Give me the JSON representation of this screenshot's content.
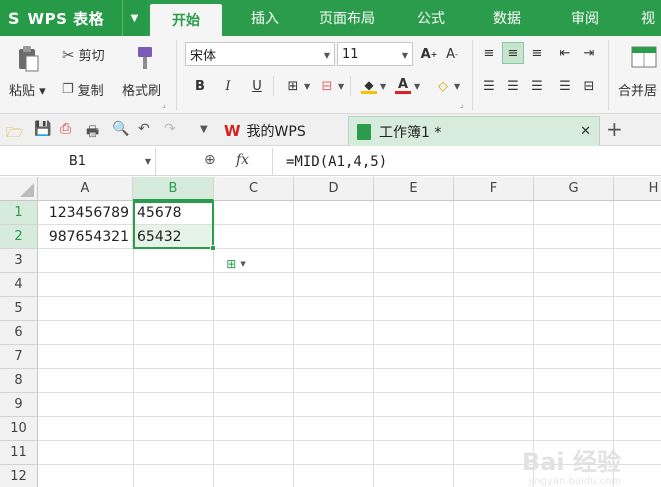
{
  "app": {
    "menu_label": "WPS 表格",
    "s_glyph": "S"
  },
  "tabs": [
    {
      "label": "开始",
      "active": true
    },
    {
      "label": "插入"
    },
    {
      "label": "页面布局"
    },
    {
      "label": "公式"
    },
    {
      "label": "数据"
    },
    {
      "label": "审阅"
    },
    {
      "label": "视"
    }
  ],
  "ribbon": {
    "paste": "粘贴",
    "cut": "剪切",
    "copy": "复制",
    "format_painter": "格式刷",
    "font_name": "宋体",
    "font_size": "11",
    "bold": "B",
    "italic": "I",
    "underline": "U",
    "merge": "合并居"
  },
  "quickbar": {
    "wps_tab": "我的WPS",
    "doc_tab": "工作簿1 *"
  },
  "formula_bar": {
    "cell_ref": "B1",
    "fx": "fx",
    "formula": "=MID(A1,4,5)"
  },
  "sheet": {
    "columns": [
      "A",
      "B",
      "C",
      "D",
      "E",
      "F",
      "G",
      "H"
    ],
    "rows": [
      "1",
      "2",
      "3",
      "4",
      "5",
      "6",
      "7",
      "8",
      "9",
      "10",
      "11",
      "12"
    ],
    "cells": {
      "A1": "123456789",
      "B1": "45678",
      "A2": "987654321",
      "B2": "65432"
    }
  },
  "watermark": {
    "main": "Bai 经验",
    "sub": "jingyan.baidu.com"
  },
  "colors": {
    "brand": "#2b9b4c",
    "active_tab_bg": "#d7ecdc"
  }
}
